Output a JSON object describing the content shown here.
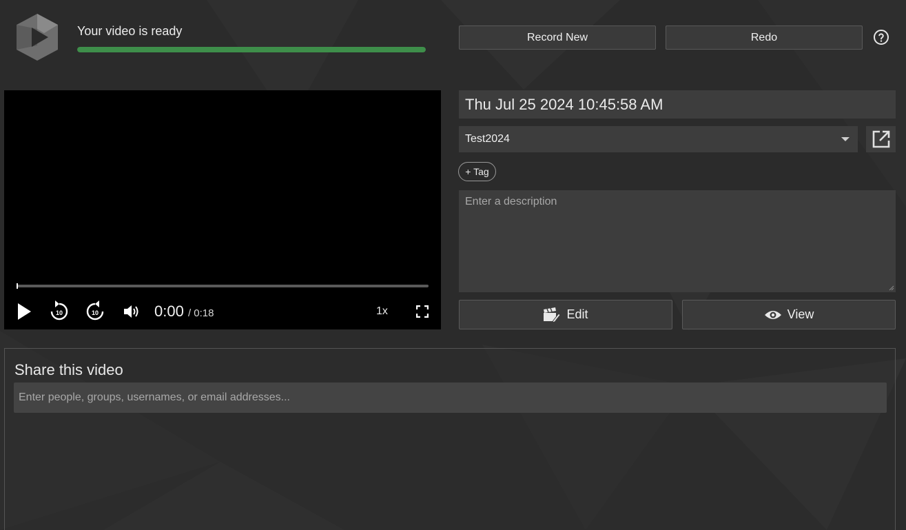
{
  "header": {
    "status_text": "Your video is ready",
    "progress": 1.0,
    "progress_color": "#3e8e4a",
    "record_new_label": "Record New",
    "redo_label": "Redo",
    "help_icon": "help-circle-icon"
  },
  "player": {
    "current_time": "0:00",
    "duration": "/ 0:18",
    "speed": "1x",
    "rewind_seconds": "10",
    "forward_seconds": "10",
    "position": 0.0
  },
  "details": {
    "title_value": "Thu Jul 25 2024 10:45:58 AM",
    "folder_value": "Test2024",
    "tag_label": "+ Tag",
    "description_placeholder": "Enter a description",
    "edit_label": "Edit",
    "view_label": "View"
  },
  "share": {
    "title": "Share this video",
    "input_placeholder": "Enter people, groups, usernames, or email addresses..."
  },
  "colors": {
    "background": "#2b2b2b",
    "input_bg": "#3d3d3d",
    "accent_green": "#3e8e4a"
  }
}
